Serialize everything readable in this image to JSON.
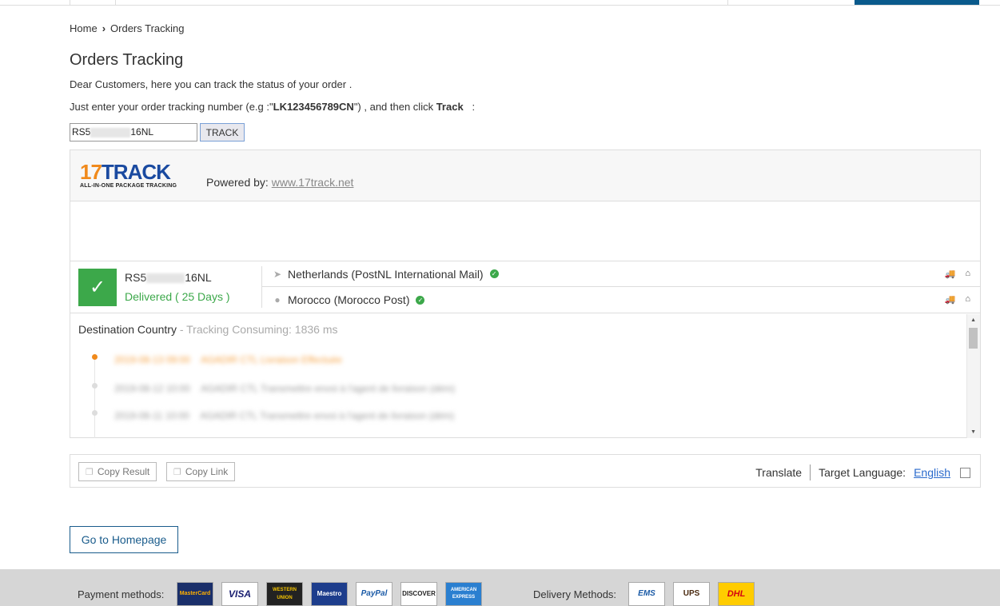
{
  "breadcrumb": {
    "home": "Home",
    "current": "Orders Tracking"
  },
  "page": {
    "title": "Orders Tracking",
    "intro": "Dear Customers, here you can track the status of your order .",
    "instruction_prefix": "Just enter your order tracking number (e.g :\"",
    "instruction_example": "LK123456789CN",
    "instruction_mid": "\") , and then click ",
    "instruction_track": "Track",
    "instruction_suffix": "   :"
  },
  "search": {
    "value_start": "RS5",
    "value_end": "16NL",
    "button_label": "TRACK"
  },
  "widget": {
    "logo_num": "17",
    "logo_text": "TRACK",
    "logo_tagline": "ALL-IN-ONE PACKAGE TRACKING",
    "powered_label": "Powered by: ",
    "powered_link": "www.17track.net",
    "result": {
      "tracking_start": "RS5",
      "tracking_end": "16NL",
      "status": "Delivered ( 25 Days )",
      "origin": "Netherlands (PostNL International Mail)",
      "destination": "Morocco (Morocco Post)"
    },
    "events_header": "Destination Country",
    "events_meta": " - Tracking Consuming: 1836 ms",
    "events": [
      {
        "date": "2019-08-13 09:00",
        "text": "AGADIR CTL Livraison Effectuée"
      },
      {
        "date": "2019-08-12 10:00",
        "text": "AGADIR CTL Transmettre envoi à l'agent de livraison (dém)"
      },
      {
        "date": "2019-08-11 10:00",
        "text": "AGADIR CTL Transmettre envoi à l'agent de livraison (dém)"
      }
    ]
  },
  "actions": {
    "copy_result": "Copy Result",
    "copy_link": "Copy Link",
    "translate": "Translate",
    "target_language_label": "Target Language:",
    "target_language": "English"
  },
  "home_button": "Go to Homepage",
  "footer": {
    "payment_label": "Payment methods:",
    "delivery_label": "Delivery Methods:",
    "payment_methods": [
      "MasterCard",
      "VISA",
      "WESTERN UNION",
      "Maestro",
      "PayPal",
      "DISCOVER",
      "AMERICAN EXPRESS"
    ],
    "delivery_methods": [
      "EMS",
      "UPS",
      "DHL"
    ]
  }
}
